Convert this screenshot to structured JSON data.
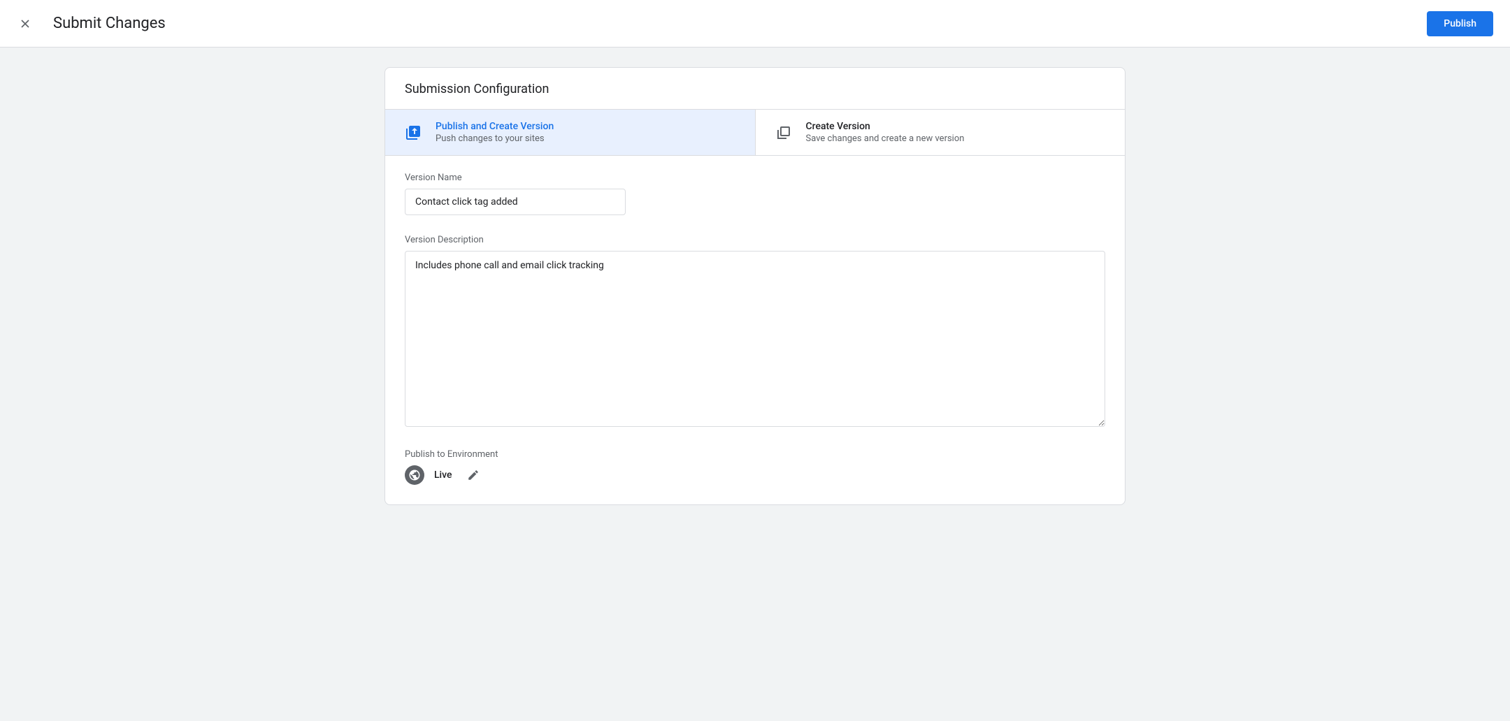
{
  "header": {
    "title": "Submit Changes",
    "publishButton": "Publish"
  },
  "card": {
    "title": "Submission Configuration"
  },
  "options": [
    {
      "title": "Publish and Create Version",
      "desc": "Push changes to your sites",
      "selected": true
    },
    {
      "title": "Create Version",
      "desc": "Save changes and create a new version",
      "selected": false
    }
  ],
  "form": {
    "versionNameLabel": "Version Name",
    "versionNameValue": "Contact click tag added",
    "versionDescLabel": "Version Description",
    "versionDescValue": "Includes phone call and email click tracking",
    "envLabel": "Publish to Environment",
    "envValue": "Live"
  }
}
